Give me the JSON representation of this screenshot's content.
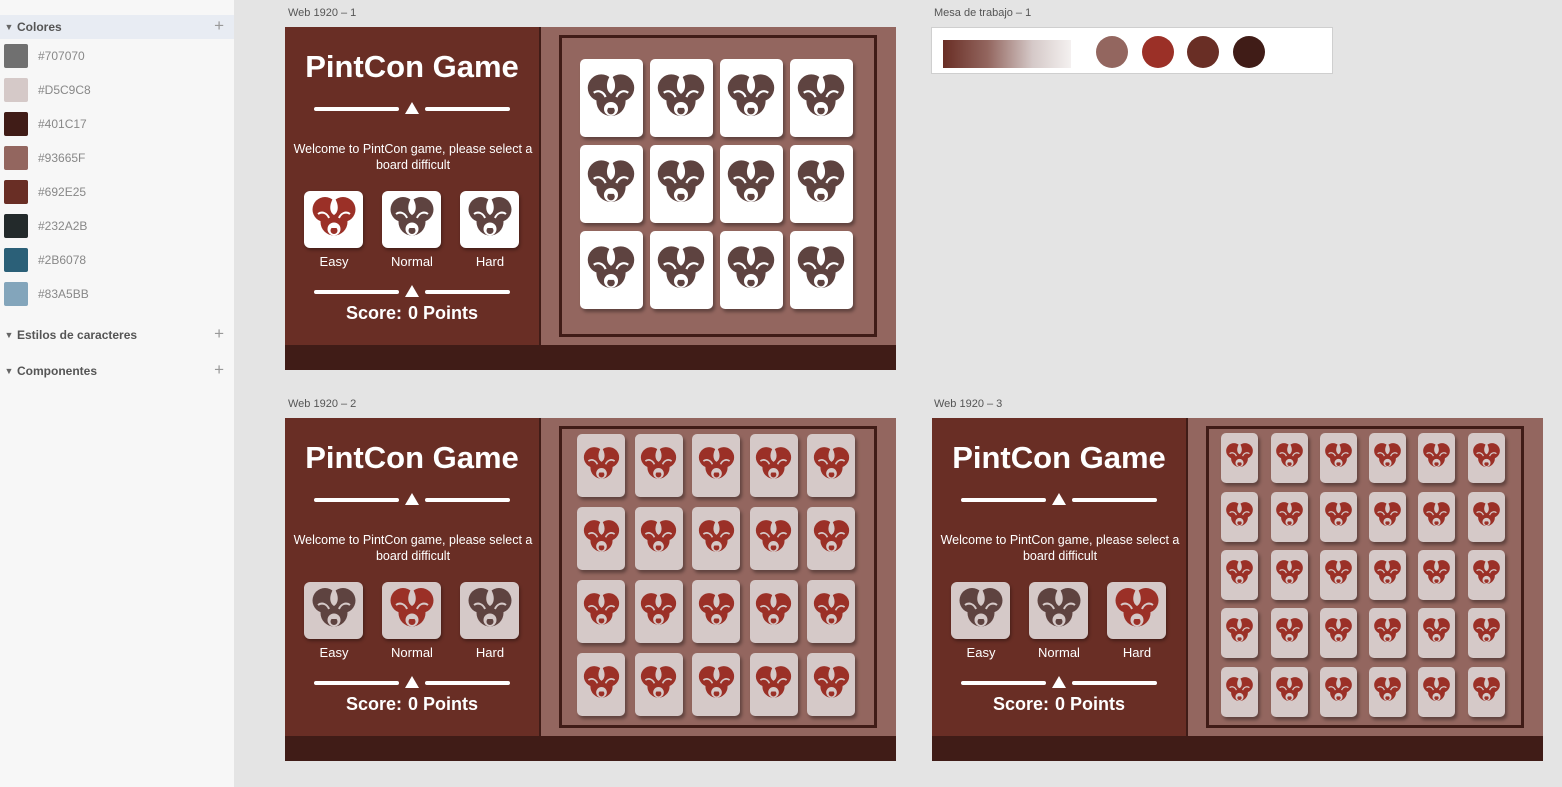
{
  "panel": {
    "colors_section": "Colores",
    "characters_section": "Estilos de caracteres",
    "components_section": "Componentes",
    "swatches": [
      {
        "label": "#707070",
        "color": "#707070"
      },
      {
        "label": "#D5C9C8",
        "color": "#D5C9C8"
      },
      {
        "label": "#401C17",
        "color": "#401C17"
      },
      {
        "label": "#93665F",
        "color": "#93665F"
      },
      {
        "label": "#692E25",
        "color": "#692E25"
      },
      {
        "label": "#232A2B",
        "color": "#232A2B"
      },
      {
        "label": "#2B6078",
        "color": "#2B6078"
      },
      {
        "label": "#83A5BB",
        "color": "#83A5BB"
      }
    ]
  },
  "palette_artboard": {
    "label": "Mesa de trabajo – 1",
    "dots": [
      "#93665F",
      "#9B3027",
      "#692E25",
      "#401C17"
    ]
  },
  "game": {
    "title": "PintCon Game",
    "welcome": "Welcome to PintCon game, please select a board difficult",
    "difficulties": [
      "Easy",
      "Normal",
      "Hard"
    ],
    "score_label": "Score:",
    "score_value": "0 Points"
  },
  "artboards": [
    {
      "label": "Web 1920 – 1",
      "selected": "Easy",
      "grid": {
        "cols": 4,
        "rows": 3
      },
      "tile_style": "white"
    },
    {
      "label": "Web 1920 – 2",
      "selected": "Normal",
      "grid": {
        "cols": 5,
        "rows": 4
      },
      "tile_style": "light"
    },
    {
      "label": "Web 1920 – 3",
      "selected": "Hard",
      "grid": {
        "cols": 6,
        "rows": 5
      },
      "tile_style": "light"
    }
  ],
  "colors": {
    "primary": "#692E25",
    "dark": "#401C17",
    "muted": "#93665F",
    "light": "#D5C9C8",
    "accent_red": "#9B3027",
    "icon_brown": "#5e4340"
  }
}
